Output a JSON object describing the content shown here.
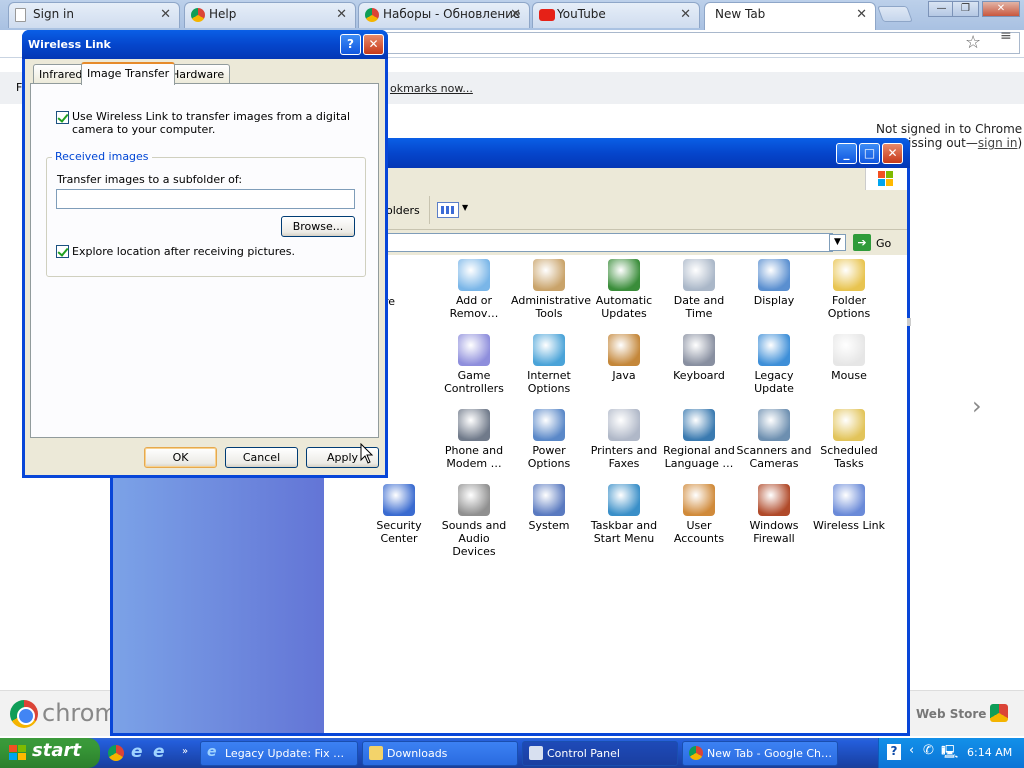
{
  "chrome": {
    "tabs": [
      {
        "label": "Sign in",
        "icon": "page-icon"
      },
      {
        "label": "Help",
        "icon": "chrome-icon"
      },
      {
        "label": "Наборы - Обновление",
        "icon": "chrome-icon"
      },
      {
        "label": "YouTube",
        "icon": "youtube-icon"
      },
      {
        "label": "New Tab",
        "icon": "none"
      }
    ],
    "bookmarks_left": "F",
    "bookmarks_link": "okmarks now...",
    "not_signed_in": "Not signed in to Chrome",
    "missing_out": "issing out—",
    "sign_in_link": "sign in",
    "close_paren": ")",
    "chrome_text": "chrom",
    "web_store": "Web Store",
    "next_arrow": "›"
  },
  "control_panel": {
    "menu_folders": "olders",
    "go_label": "Go",
    "partial_label": "re",
    "icons": [
      {
        "label": "Add or Remov…",
        "name": "add-remove-programs-icon"
      },
      {
        "label": "Administrative Tools",
        "name": "administrative-tools-icon"
      },
      {
        "label": "Automatic Updates",
        "name": "automatic-updates-icon"
      },
      {
        "label": "Date and Time",
        "name": "date-time-icon"
      },
      {
        "label": "Display",
        "name": "display-icon"
      },
      {
        "label": "Folder Options",
        "name": "folder-options-icon"
      },
      {
        "label": "Game Controllers",
        "name": "game-controllers-icon"
      },
      {
        "label": "Internet Options",
        "name": "internet-options-icon"
      },
      {
        "label": "Java",
        "name": "java-icon"
      },
      {
        "label": "Keyboard",
        "name": "keyboard-icon"
      },
      {
        "label": "Legacy Update",
        "name": "legacy-update-icon"
      },
      {
        "label": "Mouse",
        "name": "mouse-icon"
      },
      {
        "label": "Phone and Modem …",
        "name": "phone-modem-icon"
      },
      {
        "label": "Power Options",
        "name": "power-options-icon"
      },
      {
        "label": "Printers and Faxes",
        "name": "printers-faxes-icon"
      },
      {
        "label": "Regional and Language …",
        "name": "regional-language-icon"
      },
      {
        "label": "Scanners and Cameras",
        "name": "scanners-cameras-icon"
      },
      {
        "label": "Scheduled Tasks",
        "name": "scheduled-tasks-icon"
      },
      {
        "label": "Security Center",
        "name": "security-center-icon"
      },
      {
        "label": "Sounds and Audio Devices",
        "name": "sounds-audio-icon"
      },
      {
        "label": "System",
        "name": "system-icon"
      },
      {
        "label": "Taskbar and Start Menu",
        "name": "taskbar-start-menu-icon"
      },
      {
        "label": "User Accounts",
        "name": "user-accounts-icon"
      },
      {
        "label": "Windows Firewall",
        "name": "windows-firewall-icon"
      },
      {
        "label": "Wireless Link",
        "name": "wireless-link-icon"
      }
    ]
  },
  "dialog": {
    "title": "Wireless Link",
    "tabs": [
      "Infrared",
      "Image Transfer",
      "Hardware"
    ],
    "use_wireless_label": "Use Wireless Link to transfer images from a digital camera to your computer.",
    "use_wireless_checked": true,
    "group_title": "Received images",
    "subfolder_label": "Transfer images to a subfolder of:",
    "subfolder_value": "",
    "browse_label": "Browse...",
    "explore_label": "Explore location after receiving pictures.",
    "explore_checked": true,
    "ok_label": "OK",
    "cancel_label": "Cancel",
    "apply_label": "Apply"
  },
  "taskbar": {
    "start_label": "start",
    "tasks": [
      {
        "label": "Legacy Update: Fix …"
      },
      {
        "label": "Downloads"
      },
      {
        "label": "Control Panel"
      },
      {
        "label": "New Tab - Google Ch…"
      }
    ],
    "clock": "6:14 AM"
  }
}
